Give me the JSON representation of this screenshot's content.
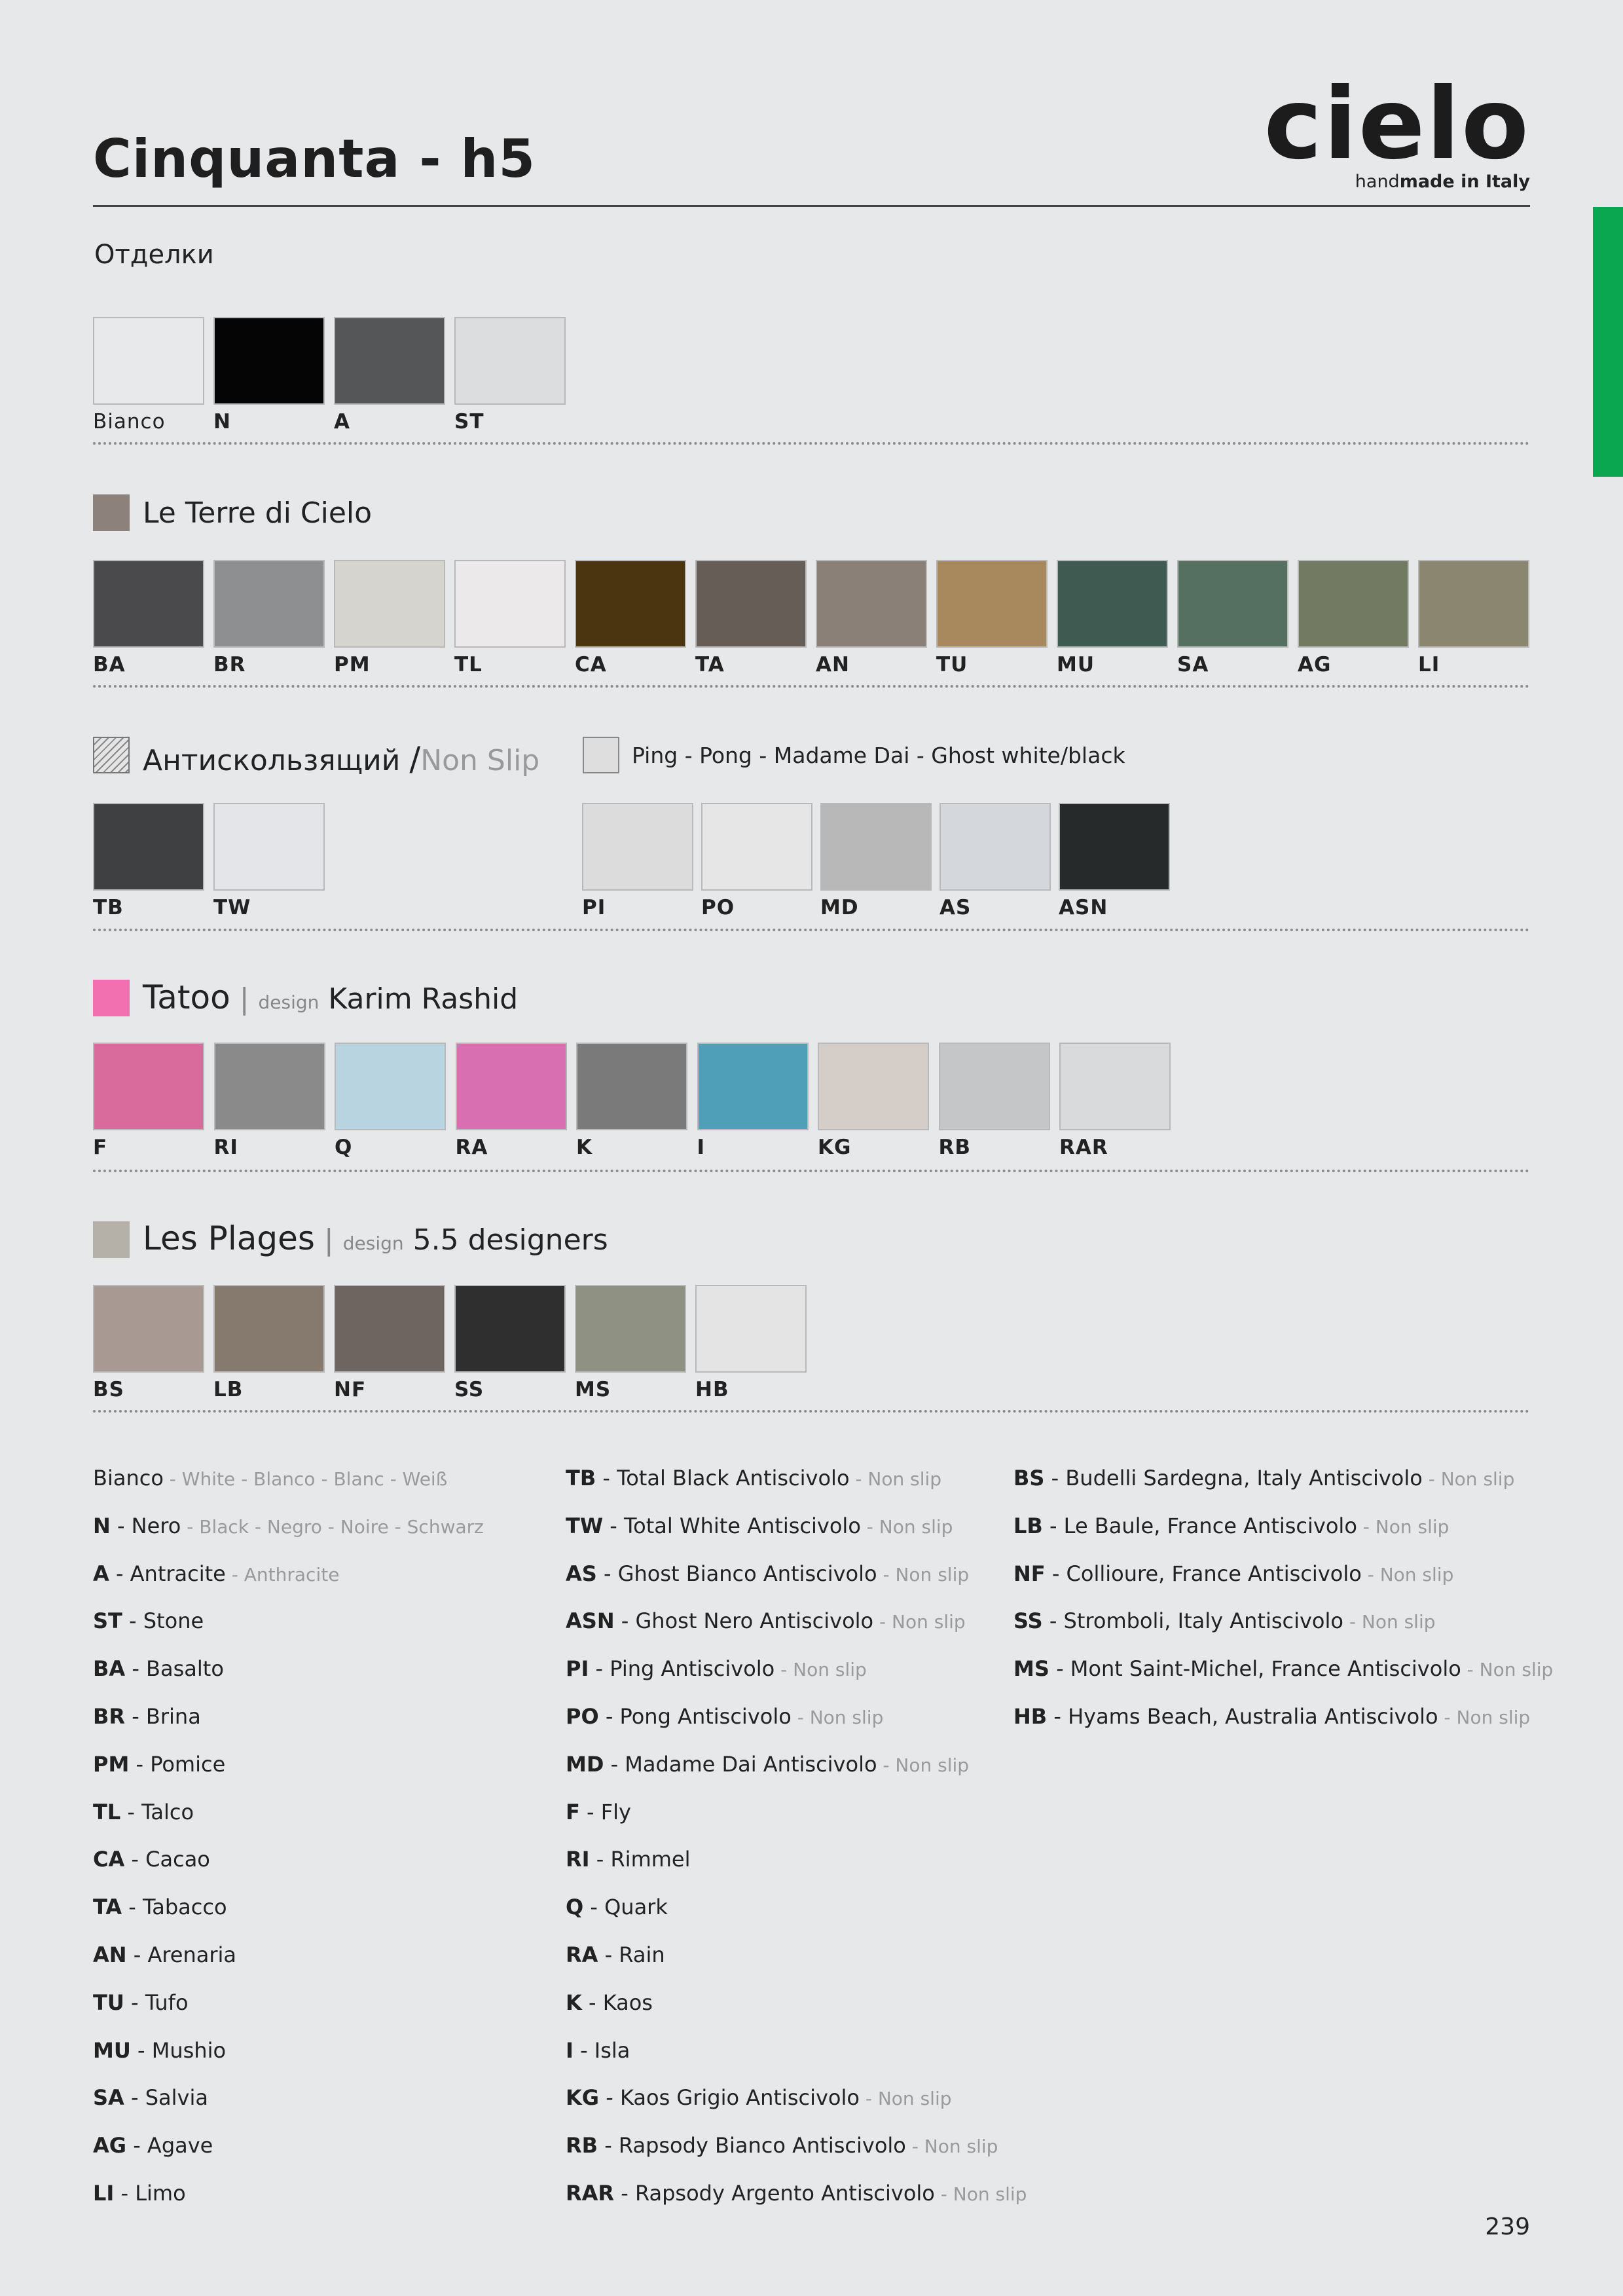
{
  "header": {
    "title": "Cinquanta - h5",
    "logo_word": "cielo",
    "logo_tag_light": "hand",
    "logo_tag_bold": "made in Italy"
  },
  "finishes": {
    "label": "Отделки",
    "swatches": [
      {
        "code": "Bianco",
        "color": "#e8e9ea",
        "bold": false
      },
      {
        "code": "N",
        "color": "#050505",
        "bold": true
      },
      {
        "code": "A",
        "color": "#555657",
        "bold": true
      },
      {
        "code": "ST",
        "color": "#dcdddf",
        "bold": true
      }
    ]
  },
  "terre": {
    "label": "Le Terre di Cielo",
    "chip_color": "#8c827b",
    "swatches": [
      {
        "code": "BA",
        "color": "#4a4a4c"
      },
      {
        "code": "BR",
        "color": "#8e8f91"
      },
      {
        "code": "PM",
        "color": "#d6d4cf"
      },
      {
        "code": "TL",
        "color": "#ebe9e9"
      },
      {
        "code": "CA",
        "color": "#4b3510"
      },
      {
        "code": "TA",
        "color": "#665d56"
      },
      {
        "code": "AN",
        "color": "#8b8077"
      },
      {
        "code": "TU",
        "color": "#a8895e"
      },
      {
        "code": "MU",
        "color": "#3f5a50"
      },
      {
        "code": "SA",
        "color": "#557060"
      },
      {
        "code": "AG",
        "color": "#737a62"
      },
      {
        "code": "LI",
        "color": "#8b8670"
      }
    ]
  },
  "nonslip": {
    "label_ru": "Антискользящий",
    "label_sep": "/",
    "label_en": "Non Slip",
    "swatches": [
      {
        "code": "TB",
        "color": "#3e4041"
      },
      {
        "code": "TW",
        "color": "#e3e5e8"
      }
    ]
  },
  "pingpong": {
    "label": "Ping - Pong - Madame Dai - Ghost white/black",
    "swatches": [
      {
        "code": "PI",
        "color": "#dcdcdc"
      },
      {
        "code": "PO",
        "color": "#e6e6e6"
      },
      {
        "code": "MD",
        "color": "#b8b8b8"
      },
      {
        "code": "AS",
        "color": "#d4d8dc"
      },
      {
        "code": "ASN",
        "color": "#262a2b"
      }
    ]
  },
  "tatoo": {
    "label": "Tatoo",
    "sep": "|",
    "design_word": "design",
    "designer": "Karim Rashid",
    "chip_color": "#f270b0",
    "swatches": [
      {
        "code": "F",
        "color": "#d86a9c"
      },
      {
        "code": "RI",
        "color": "#8a8a8a"
      },
      {
        "code": "Q",
        "color": "#b8d4e0"
      },
      {
        "code": "RA",
        "color": "#d86fb0"
      },
      {
        "code": "K",
        "color": "#7a7a7a"
      },
      {
        "code": "I",
        "color": "#4f9fb8"
      },
      {
        "code": "KG",
        "color": "#d4cdc8"
      },
      {
        "code": "RB",
        "color": "#c4c6c8"
      },
      {
        "code": "RAR",
        "color": "#d8dadb"
      }
    ]
  },
  "plages": {
    "label": "Les Plages",
    "sep": "|",
    "design_word": "design",
    "designer": "5.5 designers",
    "chip_color": "#b5b0a8",
    "swatches": [
      {
        "code": "BS",
        "color": "#a89a93"
      },
      {
        "code": "LB",
        "color": "#857a6d"
      },
      {
        "code": "NF",
        "color": "#6e6560"
      },
      {
        "code": "SS",
        "color": "#2f2f2f"
      },
      {
        "code": "MS",
        "color": "#8f9282"
      },
      {
        "code": "HB",
        "color": "#e4e4e4"
      }
    ]
  },
  "legend": {
    "col1": [
      {
        "code": "Bianco",
        "code_bold": false,
        "name": "",
        "note": "- White - Blanco - Blanc - Weiß"
      },
      {
        "code": "N",
        "code_bold": true,
        "name": "- Nero",
        "note": "- Black - Negro - Noire - Schwarz"
      },
      {
        "code": "A",
        "code_bold": true,
        "name": "- Antracite",
        "note": "- Anthracite"
      },
      {
        "code": "ST",
        "code_bold": true,
        "name": "- Stone",
        "note": ""
      },
      {
        "code": "BA",
        "code_bold": true,
        "name": "- Basalto",
        "note": ""
      },
      {
        "code": "BR",
        "code_bold": true,
        "name": "- Brina",
        "note": ""
      },
      {
        "code": "PM",
        "code_bold": true,
        "name": "- Pomice",
        "note": ""
      },
      {
        "code": "TL",
        "code_bold": true,
        "name": "- Talco",
        "note": ""
      },
      {
        "code": "CA",
        "code_bold": true,
        "name": "- Cacao",
        "note": ""
      },
      {
        "code": "TA",
        "code_bold": true,
        "name": "- Tabacco",
        "note": ""
      },
      {
        "code": "AN",
        "code_bold": true,
        "name": "- Arenaria",
        "note": ""
      },
      {
        "code": "TU",
        "code_bold": true,
        "name": "- Tufo",
        "note": ""
      },
      {
        "code": "MU",
        "code_bold": true,
        "name": "- Mushio",
        "note": ""
      },
      {
        "code": "SA",
        "code_bold": true,
        "name": "- Salvia",
        "note": ""
      },
      {
        "code": "AG",
        "code_bold": true,
        "name": "- Agave",
        "note": ""
      },
      {
        "code": "LI",
        "code_bold": true,
        "name": "- Limo",
        "note": ""
      }
    ],
    "col2": [
      {
        "code": "TB",
        "name": "- Total Black Antiscivolo",
        "note": "- Non slip"
      },
      {
        "code": "TW",
        "name": "- Total White Antiscivolo",
        "note": "- Non slip"
      },
      {
        "code": "AS",
        "name": "- Ghost Bianco Antiscivolo",
        "note": "- Non slip"
      },
      {
        "code": "ASN",
        "name": "- Ghost Nero Antiscivolo",
        "note": "- Non slip"
      },
      {
        "code": "PI",
        "name": "- Ping Antiscivolo",
        "note": "- Non slip"
      },
      {
        "code": "PO",
        "name": "- Pong Antiscivolo",
        "note": "- Non slip"
      },
      {
        "code": "MD",
        "name": "- Madame Dai Antiscivolo",
        "note": "- Non slip"
      },
      {
        "code": "F",
        "name": "- Fly",
        "note": ""
      },
      {
        "code": "RI",
        "name": "- Rimmel",
        "note": ""
      },
      {
        "code": "Q",
        "name": "- Quark",
        "note": ""
      },
      {
        "code": "RA",
        "name": "- Rain",
        "note": ""
      },
      {
        "code": "K",
        "name": "- Kaos",
        "note": ""
      },
      {
        "code": "I",
        "name": "- Isla",
        "note": ""
      },
      {
        "code": "KG",
        "name": "- Kaos Grigio Antiscivolo",
        "note": "- Non slip"
      },
      {
        "code": "RB",
        "name": "- Rapsody Bianco Antiscivolo",
        "note": "- Non slip"
      },
      {
        "code": "RAR",
        "name": "- Rapsody Argento Antiscivolo",
        "note": "- Non slip"
      }
    ],
    "col3": [
      {
        "code": "BS",
        "name": "- Budelli Sardegna, Italy Antiscivolo",
        "note": "- Non slip"
      },
      {
        "code": "LB",
        "name": "- Le Baule, France Antiscivolo",
        "note": "- Non slip"
      },
      {
        "code": "NF",
        "name": "- Collioure, France Antiscivolo",
        "note": "- Non slip"
      },
      {
        "code": "SS",
        "name": "- Stromboli, Italy Antiscivolo",
        "note": "- Non slip"
      },
      {
        "code": "MS",
        "name": "- Mont Saint-Michel, France Antiscivolo",
        "note": "- Non slip"
      },
      {
        "code": "HB",
        "name": "- Hyams Beach, Australia Antiscivolo",
        "note": "- Non slip"
      }
    ]
  },
  "page_number": "239"
}
